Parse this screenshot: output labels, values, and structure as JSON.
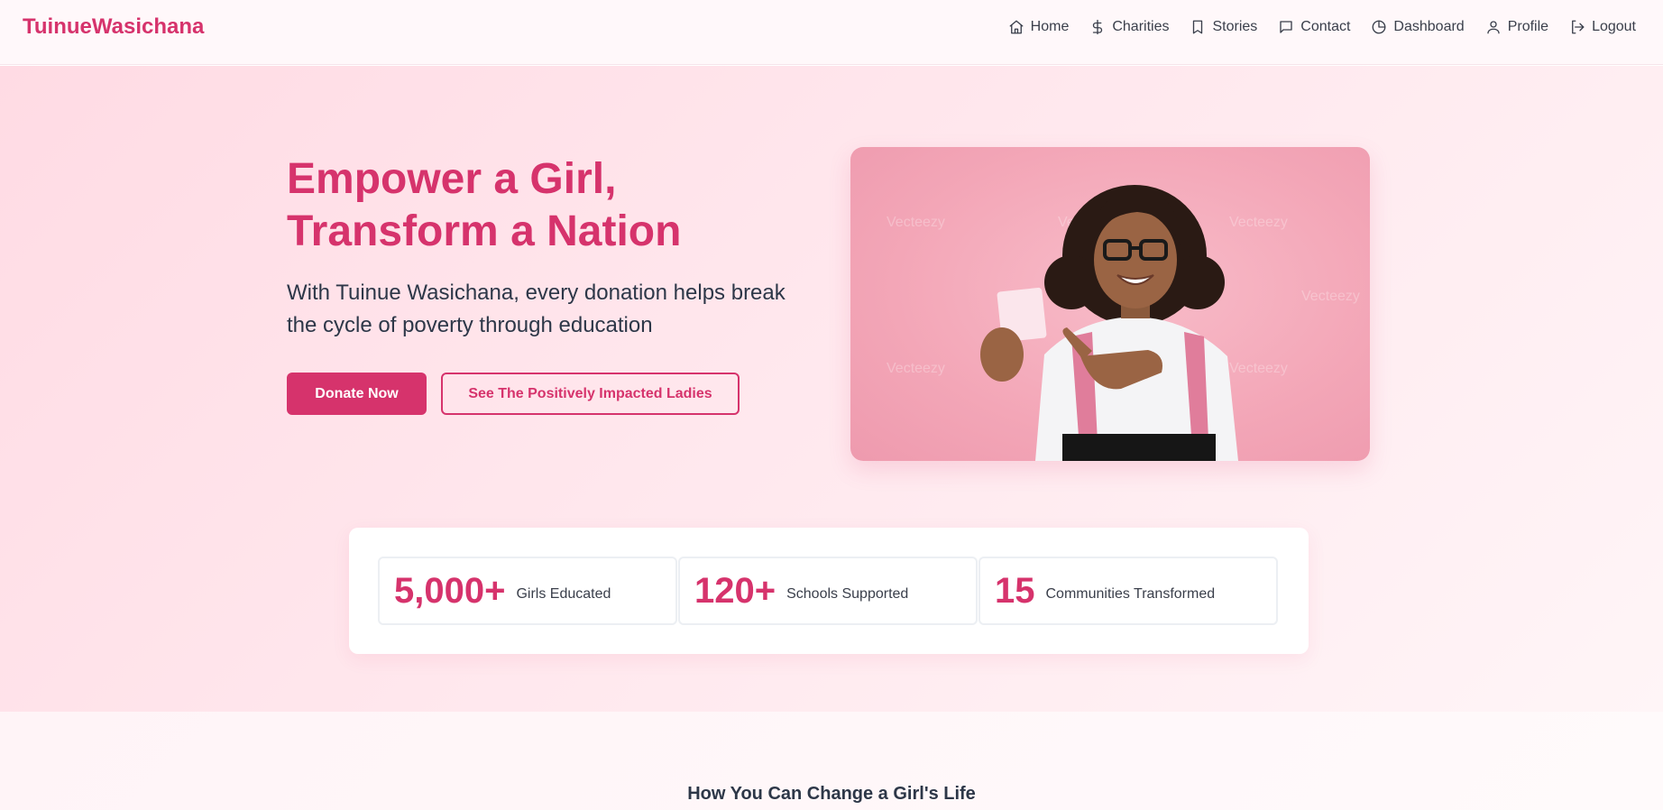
{
  "brand": {
    "name": "TuinueWasichana",
    "accent": "#d6336c"
  },
  "nav": {
    "items": [
      {
        "label": "Home",
        "icon": "home-icon"
      },
      {
        "label": "Charities",
        "icon": "dollar-icon"
      },
      {
        "label": "Stories",
        "icon": "bookmark-icon"
      },
      {
        "label": "Contact",
        "icon": "message-icon"
      },
      {
        "label": "Dashboard",
        "icon": "pie-chart-icon"
      },
      {
        "label": "Profile",
        "icon": "user-icon"
      },
      {
        "label": "Logout",
        "icon": "logout-icon"
      }
    ]
  },
  "hero": {
    "title": "Empower a Girl, Transform a Nation",
    "subtitle": "With Tuinue Wasichana, every donation helps break the cycle of poverty through education",
    "primary_button": "Donate Now",
    "secondary_button": "See The Positively Impacted Ladies",
    "image_watermark": "Vecteezy"
  },
  "stats": [
    {
      "value": "5,000+",
      "label": "Girls Educated"
    },
    {
      "value": "120+",
      "label": "Schools Supported"
    },
    {
      "value": "15",
      "label": "Communities Transformed"
    }
  ],
  "section2": {
    "title": "How You Can Change a Girl's Life"
  }
}
